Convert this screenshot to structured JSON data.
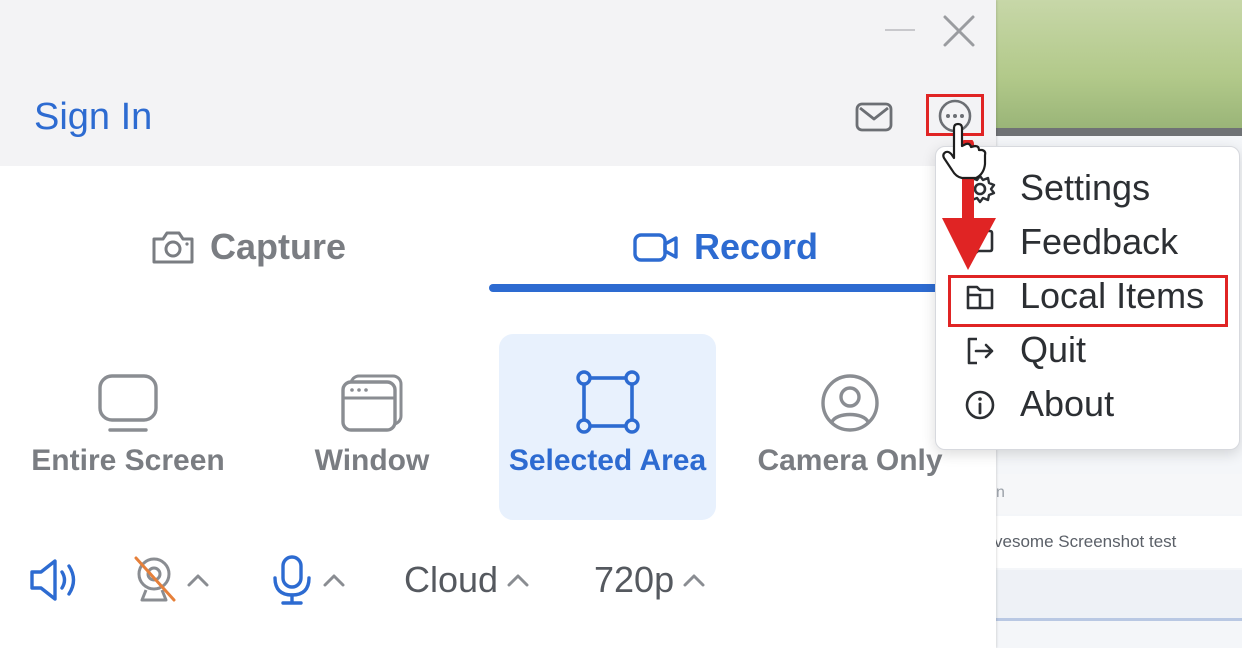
{
  "background_app": {
    "row1_text": "n",
    "row2_text": "vesome Screenshot test"
  },
  "header": {
    "sign_in": "Sign In",
    "icons": [
      "minimize-icon",
      "close-icon",
      "mail-icon",
      "more-options-icon"
    ]
  },
  "tabs": [
    {
      "label": "Capture",
      "icon": "camera-icon",
      "active": false
    },
    {
      "label": "Record",
      "icon": "video-camera-icon",
      "active": true
    }
  ],
  "sources": [
    {
      "label": "Entire Screen",
      "icon": "monitor-icon",
      "selected": false
    },
    {
      "label": "Window",
      "icon": "window-icon",
      "selected": false
    },
    {
      "label": "Selected Area",
      "icon": "selection-area-icon",
      "selected": true
    },
    {
      "label": "Camera Only",
      "icon": "user-circle-icon",
      "selected": false
    }
  ],
  "controls": {
    "storage": "Cloud",
    "resolution": "720p",
    "icons": [
      "speaker-icon",
      "camera-off-icon",
      "microphone-icon"
    ]
  },
  "menu": {
    "items": [
      {
        "label": "Settings",
        "icon": "gear-icon"
      },
      {
        "label": "Feedback",
        "icon": "feedback-icon"
      },
      {
        "label": "Local Items",
        "icon": "folder-icon",
        "highlighted": true
      },
      {
        "label": "Quit",
        "icon": "logout-icon"
      },
      {
        "label": "About",
        "icon": "info-icon"
      }
    ]
  },
  "colors": {
    "accent": "#2d6bd1",
    "annotation_red": "#e02424",
    "muted_text": "#7a7d82",
    "selected_bg": "#e8f1fd"
  }
}
